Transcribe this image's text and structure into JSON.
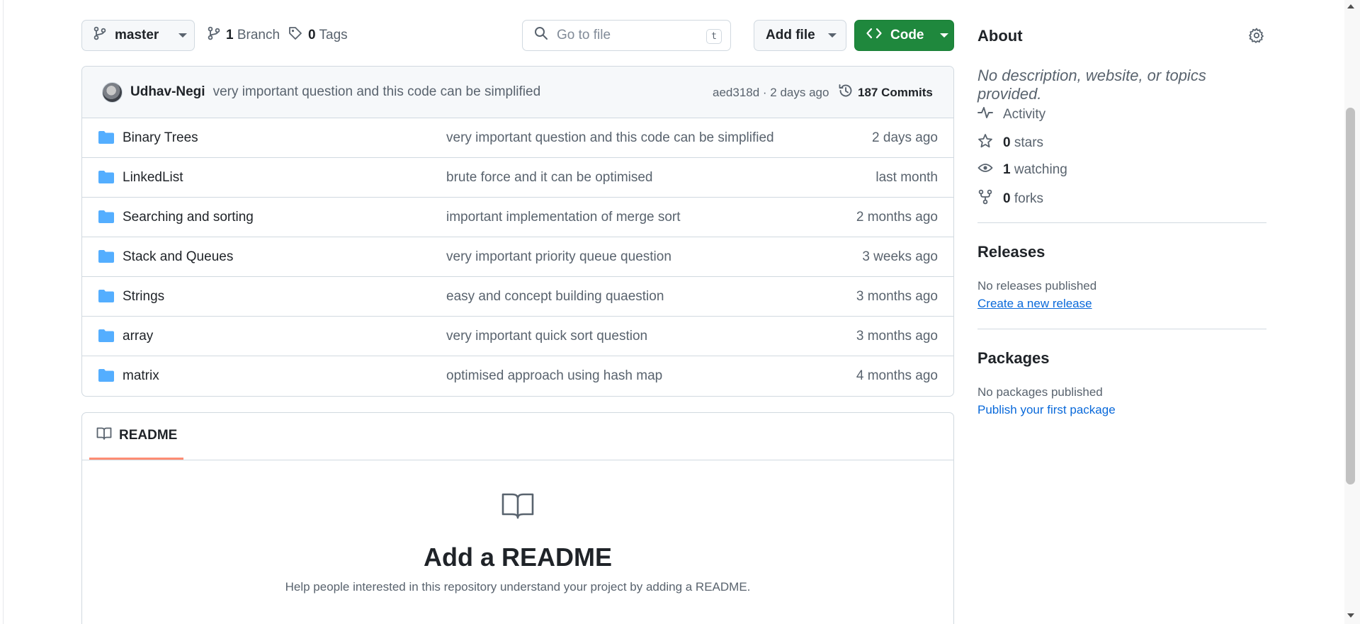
{
  "toolbar": {
    "branch_name": "master",
    "branches_count": "1",
    "branches_label": "Branch",
    "tags_count": "0",
    "tags_label": "Tags",
    "search_placeholder": "Go to file",
    "search_shortcut": "t",
    "add_file_label": "Add file",
    "code_label": "Code"
  },
  "latest_commit": {
    "author": "Udhav-Negi",
    "message": "very important question and this code can be simplified",
    "meta": "aed318d · 2 days ago",
    "commits_count": "187 Commits"
  },
  "files": [
    {
      "name": "Binary Trees",
      "message": "very important question and this code can be simplified",
      "date": "2 days ago"
    },
    {
      "name": "LinkedList",
      "message": "brute force and it can be optimised",
      "date": "last month"
    },
    {
      "name": "Searching and sorting",
      "message": "important implementation of merge sort",
      "date": "2 months ago"
    },
    {
      "name": "Stack and Queues",
      "message": "very important priority queue question",
      "date": "3 weeks ago"
    },
    {
      "name": "Strings",
      "message": "easy and concept building quaestion",
      "date": "3 months ago"
    },
    {
      "name": "array",
      "message": "very important quick sort question",
      "date": "3 months ago"
    },
    {
      "name": "matrix",
      "message": "optimised approach using hash map",
      "date": "4 months ago"
    }
  ],
  "readme": {
    "tab_label": "README",
    "empty_title": "Add a README",
    "empty_description": "Help people interested in this repository understand your project by adding a README."
  },
  "sidebar": {
    "about_title": "About",
    "about_description": "No description, website, or topics provided.",
    "activity_label": "Activity",
    "stars_count": "0",
    "stars_label": "stars",
    "watching_count": "1",
    "watching_label": "watching",
    "forks_count": "0",
    "forks_label": "forks",
    "releases_title": "Releases",
    "releases_text": "No releases published",
    "releases_link": "Create a new release",
    "packages_title": "Packages",
    "packages_text": "No packages published",
    "packages_link": "Publish your first package"
  },
  "colors": {
    "code_button": "#1f883d",
    "link": "#0969da",
    "folder": "#54aeff",
    "tab_underline": "#fd8c73"
  }
}
